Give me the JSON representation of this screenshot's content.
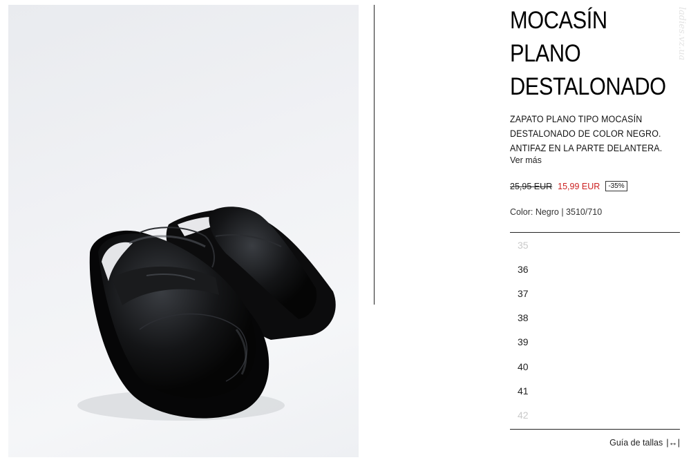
{
  "product": {
    "title_lines": [
      "MOCASÍN",
      "PLANO",
      "DESTALONADO"
    ],
    "description_lines": [
      "ZAPATO PLANO TIPO MOCASÍN",
      "DESTALONADO DE COLOR NEGRO.",
      "ANTIFAZ EN LA PARTE DELANTERA."
    ],
    "see_more": "Ver más",
    "old_price": "25,95 EUR",
    "sale_price": "15,99 EUR",
    "discount": "-35%",
    "color_line": "Color: Negro | 3510/710",
    "image_alt": "black-mule-loafers-photo"
  },
  "sizes": [
    {
      "label": "35",
      "available": false
    },
    {
      "label": "36",
      "available": true
    },
    {
      "label": "37",
      "available": true
    },
    {
      "label": "38",
      "available": true
    },
    {
      "label": "39",
      "available": true
    },
    {
      "label": "40",
      "available": true
    },
    {
      "label": "41",
      "available": true
    },
    {
      "label": "42",
      "available": false
    }
  ],
  "size_guide": {
    "label": "Guía de tallas",
    "icon": "resize-horizontal-icon"
  },
  "watermark": "ladies.vz.ua",
  "colors": {
    "sale": "#cc1f1f",
    "unavailable": "#c9c9c9",
    "text": "#111111"
  }
}
